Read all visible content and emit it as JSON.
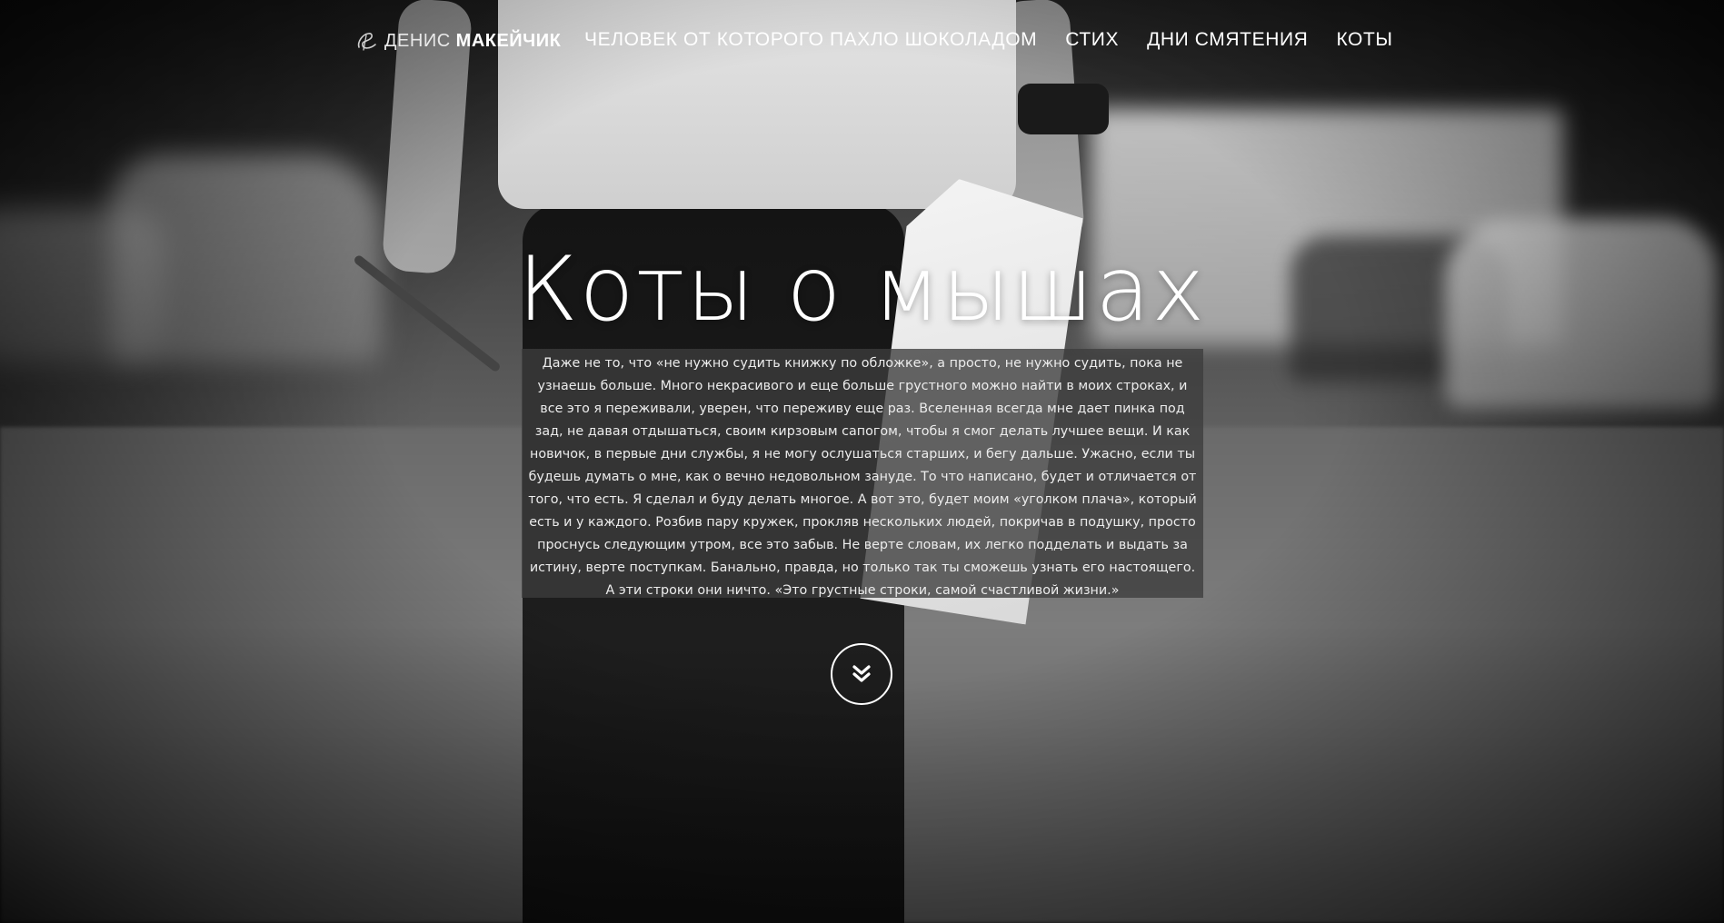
{
  "header": {
    "brand": {
      "first_name": "ДЕНИС",
      "last_name": "МАКЕЙЧИК",
      "logo_icon": "signature-logo-icon"
    },
    "nav": [
      {
        "label": "ЧЕЛОВЕК ОТ КОТОРОГО ПАХЛО ШОКОЛАДОМ"
      },
      {
        "label": "СТИХ"
      },
      {
        "label": "ДНИ СМЯТЕНИЯ"
      },
      {
        "label": "КОТЫ"
      }
    ]
  },
  "hero": {
    "title": "Коты о мышах",
    "description": "Даже не то, что «не нужно судить книжку по обложке», а просто, не нужно судить, пока не узнаешь больше. Много некрасивого и еще больше грустного можно найти в моих строках, и все это я переживали, уверен, что переживу еще раз. Вселенная всегда мне дает пинка под зад, не давая отдышаться, своим кирзовым сапогом, чтобы я смог делать лучшее вещи. И как новичок, в первые дни службы, я не могу ослушаться старших, и бегу дальше. Ужасно, если ты будешь думать о мне, как о вечно недовольном зануде. То что написано, будет и отличается от того, что есть. Я сделал и буду делать многое. А вот это, будет моим «уголком плача», который есть и у каждого. Розбив пару кружек, прокляв нескольких людей, покричав в подушку, просто проснусь следующим утром, все это забыв. Не верте словам, их легко подделать и выдать за истину, верте поступкам. Банально, правда, но только так ты сможешь узнать его настоящего. А эти строки они ничто. «Это грустные строки, самой счастливой жизни.»",
    "scroll_icon": "double-chevron-down-icon"
  },
  "colors": {
    "text": "#ffffff",
    "desc_box": "#3c3c3c"
  }
}
